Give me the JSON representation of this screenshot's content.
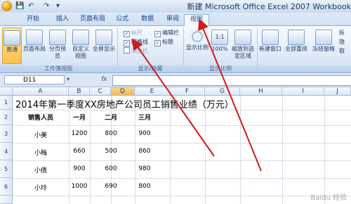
{
  "window": {
    "title": "新建 Microsoft Office Excel 2007 Workbook"
  },
  "tabs": [
    "开始",
    "插入",
    "页面布局",
    "公式",
    "数据",
    "审阅",
    "视图"
  ],
  "active_tab": "视图",
  "ribbon": {
    "workbook_views": {
      "label": "工作簿视图",
      "buttons": [
        "普通",
        "页面布局",
        "分页预览",
        "自定义视图",
        "全屏显示"
      ]
    },
    "show_hide": {
      "label": "显示/隐藏",
      "checkboxes": [
        {
          "label": "标尺",
          "checked": true,
          "disabled": true
        },
        {
          "label": "网格线",
          "checked": true,
          "disabled": false
        },
        {
          "label": "消息栏",
          "checked": false,
          "disabled": true
        },
        {
          "label": "编辑栏",
          "checked": true,
          "disabled": false
        },
        {
          "label": "标题",
          "checked": true,
          "disabled": false
        }
      ]
    },
    "zoom": {
      "label": "显示比例",
      "buttons": [
        "显示比例",
        "100%",
        "缩放到选定区域"
      ]
    },
    "window": {
      "buttons": [
        "新建窗口",
        "全部重排",
        "冻结窗格"
      ],
      "more": [
        "拆",
        "隐",
        "取"
      ]
    }
  },
  "formula_bar": {
    "name_box": "D11",
    "fx": "fx",
    "value": ""
  },
  "columns": [
    "A",
    "B",
    "C",
    "D",
    "E",
    "F",
    "G",
    "H",
    "I",
    "J"
  ],
  "rows": [
    "1",
    "2",
    "3",
    "4",
    "5",
    "6"
  ],
  "sheet": {
    "title": "2014年第一季度XX房地产公司员工销售业绩（万元）",
    "headers": [
      "销售人员",
      "一月",
      "二月",
      "三月"
    ],
    "data": [
      [
        "小美",
        "1200",
        "800",
        "900"
      ],
      [
        "小梅",
        "660",
        "500",
        "860"
      ],
      [
        "小倩",
        "900",
        "600",
        "980"
      ],
      [
        "小玲",
        "1000",
        "690",
        "800"
      ]
    ]
  },
  "watermark": "Baidu 经验",
  "colors": {
    "arrow": "#d11a1a",
    "active_tab_bg": "#f5f9ff",
    "selected_button": "#ffc04b"
  }
}
